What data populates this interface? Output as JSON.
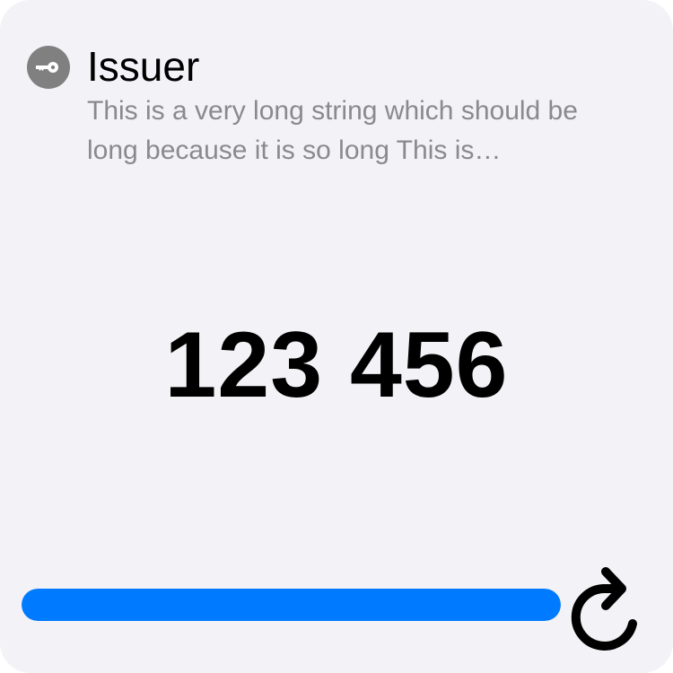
{
  "account": {
    "icon": "key-icon",
    "issuer": "Issuer",
    "description": "This is a very long string which should be long because it is so long This is…"
  },
  "code": "123 456",
  "progress": {
    "value": 1.0,
    "color": "#007aff"
  },
  "refresh": {
    "icon": "refresh-icon"
  }
}
